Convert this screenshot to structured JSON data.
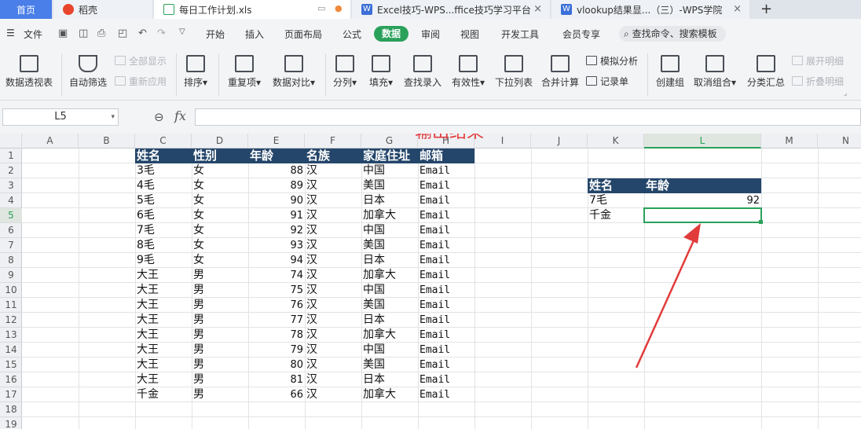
{
  "tabs": {
    "home": "首页",
    "docer": "稻壳",
    "file": "每日工作计划.xls",
    "web1": "Excel技巧-WPS...ffice技巧学习平台",
    "web2": "vlookup结果显...（三）-WPS学院",
    "close": "×",
    "new": "+"
  },
  "menu": {
    "file": "文件",
    "items": [
      "开始",
      "插入",
      "页面布局",
      "公式",
      "数据",
      "审阅",
      "视图",
      "开发工具",
      "会员专享"
    ],
    "search": "查找命令、搜索模板"
  },
  "ribbon": {
    "pivot": "数据透视表",
    "autofilter": "自动筛选",
    "show_all": "全部显示",
    "reapply": "重新应用",
    "sort": "排序",
    "duplicates": "重复项",
    "compare": "数据对比",
    "split": "分列",
    "fill": "填充",
    "find_entry": "查找录入",
    "validity": "有效性",
    "dropdown": "下拉列表",
    "consolidate": "合并计算",
    "simulate": "模拟分析",
    "record": "记录单",
    "group": "创建组",
    "ungroup": "取消组合",
    "subtotal": "分类汇总",
    "expand": "展开明细",
    "collapse": "折叠明细"
  },
  "formula_bar": {
    "name_box": "L5",
    "fx": "fx",
    "formula": ""
  },
  "columns": [
    "A",
    "B",
    "C",
    "D",
    "E",
    "F",
    "G",
    "H",
    "I",
    "J",
    "K",
    "L",
    "M",
    "N"
  ],
  "rows": [
    "1",
    "2",
    "3",
    "4",
    "5",
    "6",
    "7",
    "8",
    "9",
    "10",
    "11",
    "12",
    "13",
    "14",
    "15",
    "16",
    "17",
    "18",
    "19"
  ],
  "table": {
    "headers": [
      "姓名",
      "性别",
      "年龄",
      "名族",
      "家庭住址",
      "邮箱"
    ],
    "rows": [
      [
        "3毛",
        "女",
        "88",
        "汉",
        "中国",
        "Email"
      ],
      [
        "4毛",
        "女",
        "89",
        "汉",
        "美国",
        "Email"
      ],
      [
        "5毛",
        "女",
        "90",
        "汉",
        "日本",
        "Email"
      ],
      [
        "6毛",
        "女",
        "91",
        "汉",
        "加拿大",
        "Email"
      ],
      [
        "7毛",
        "女",
        "92",
        "汉",
        "中国",
        "Email"
      ],
      [
        "8毛",
        "女",
        "93",
        "汉",
        "美国",
        "Email"
      ],
      [
        "9毛",
        "女",
        "94",
        "汉",
        "日本",
        "Email"
      ],
      [
        "大王",
        "男",
        "74",
        "汉",
        "加拿大",
        "Email"
      ],
      [
        "大王",
        "男",
        "75",
        "汉",
        "中国",
        "Email"
      ],
      [
        "大王",
        "男",
        "76",
        "汉",
        "美国",
        "Email"
      ],
      [
        "大王",
        "男",
        "77",
        "汉",
        "日本",
        "Email"
      ],
      [
        "大王",
        "男",
        "78",
        "汉",
        "加拿大",
        "Email"
      ],
      [
        "大王",
        "男",
        "79",
        "汉",
        "中国",
        "Email"
      ],
      [
        "大王",
        "男",
        "80",
        "汉",
        "美国",
        "Email"
      ],
      [
        "大王",
        "男",
        "81",
        "汉",
        "日本",
        "Email"
      ],
      [
        "千金",
        "男",
        "66",
        "汉",
        "加拿大",
        "Email"
      ]
    ]
  },
  "lookup": {
    "headers": [
      "姓名",
      "年龄"
    ],
    "rows": [
      [
        "7毛",
        "92"
      ],
      [
        "千金",
        ""
      ]
    ]
  },
  "annotation": "输出结果",
  "colors": {
    "header_fill": "#24466a",
    "accent_green": "#2aa15a",
    "annotation_red": "#e23b3b",
    "home_tab": "#4a7ee8"
  }
}
